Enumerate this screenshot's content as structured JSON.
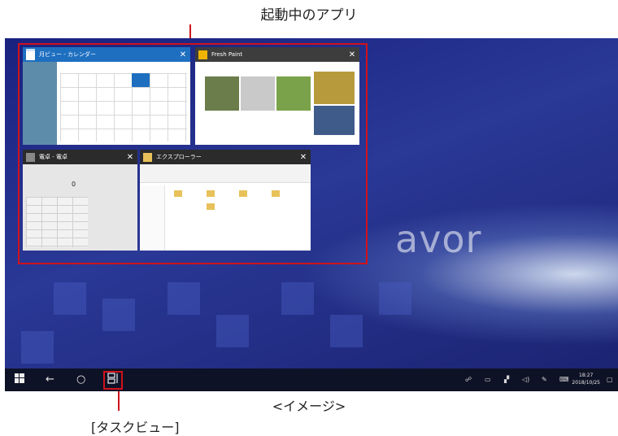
{
  "annotations": {
    "running_apps": "起動中のアプリ",
    "task_view": "[タスクビュー]",
    "caption": "<イメージ>"
  },
  "desktop": {
    "brand_text": "avor"
  },
  "windows": [
    {
      "title": "月ビュー - カレンダー",
      "icon": "calendar-icon",
      "close": "✕"
    },
    {
      "title": "Fresh Paint",
      "icon": "fresh-paint-icon",
      "close": "✕"
    },
    {
      "title": "電卓 - 電卓",
      "icon": "calculator-icon",
      "close": "✕"
    },
    {
      "title": "エクスプローラー",
      "icon": "folder-icon",
      "close": "✕"
    }
  ],
  "calculator": {
    "display": "0"
  },
  "taskbar": {
    "time": "18:27",
    "date": "2018/10/25",
    "buttons": [
      "start-icon",
      "back-icon",
      "cortana-icon",
      "task-view-icon"
    ]
  },
  "colors": {
    "highlight": "#d0121b",
    "calendar_accent": "#1e6fc0",
    "taskbar": "#0e1226"
  }
}
